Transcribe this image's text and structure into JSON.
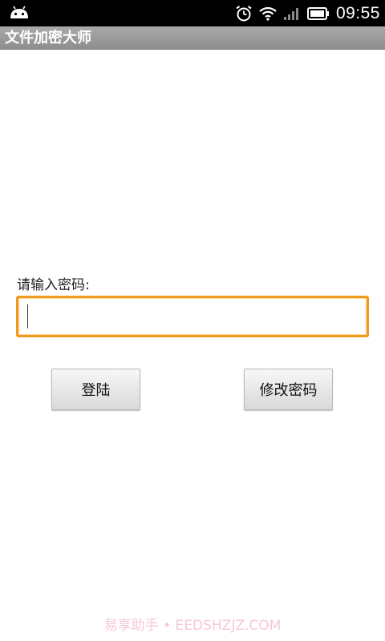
{
  "status_bar": {
    "time": "09:55",
    "icons": [
      "android-icon",
      "alarm-clock-icon",
      "wifi-icon",
      "signal-icon",
      "battery-icon"
    ]
  },
  "title_bar": {
    "title": "文件加密大师"
  },
  "form": {
    "password_label": "请输入密码:",
    "password_value": "",
    "login_label": "登陆",
    "change_password_label": "修改密码"
  },
  "watermark": {
    "text": "易享助手 • EEDSHZJZ.COM"
  },
  "colors": {
    "status_bar_bg": "#000000",
    "title_bar_bg": "#9a9a9a",
    "input_focus_border": "#f29a1f"
  }
}
